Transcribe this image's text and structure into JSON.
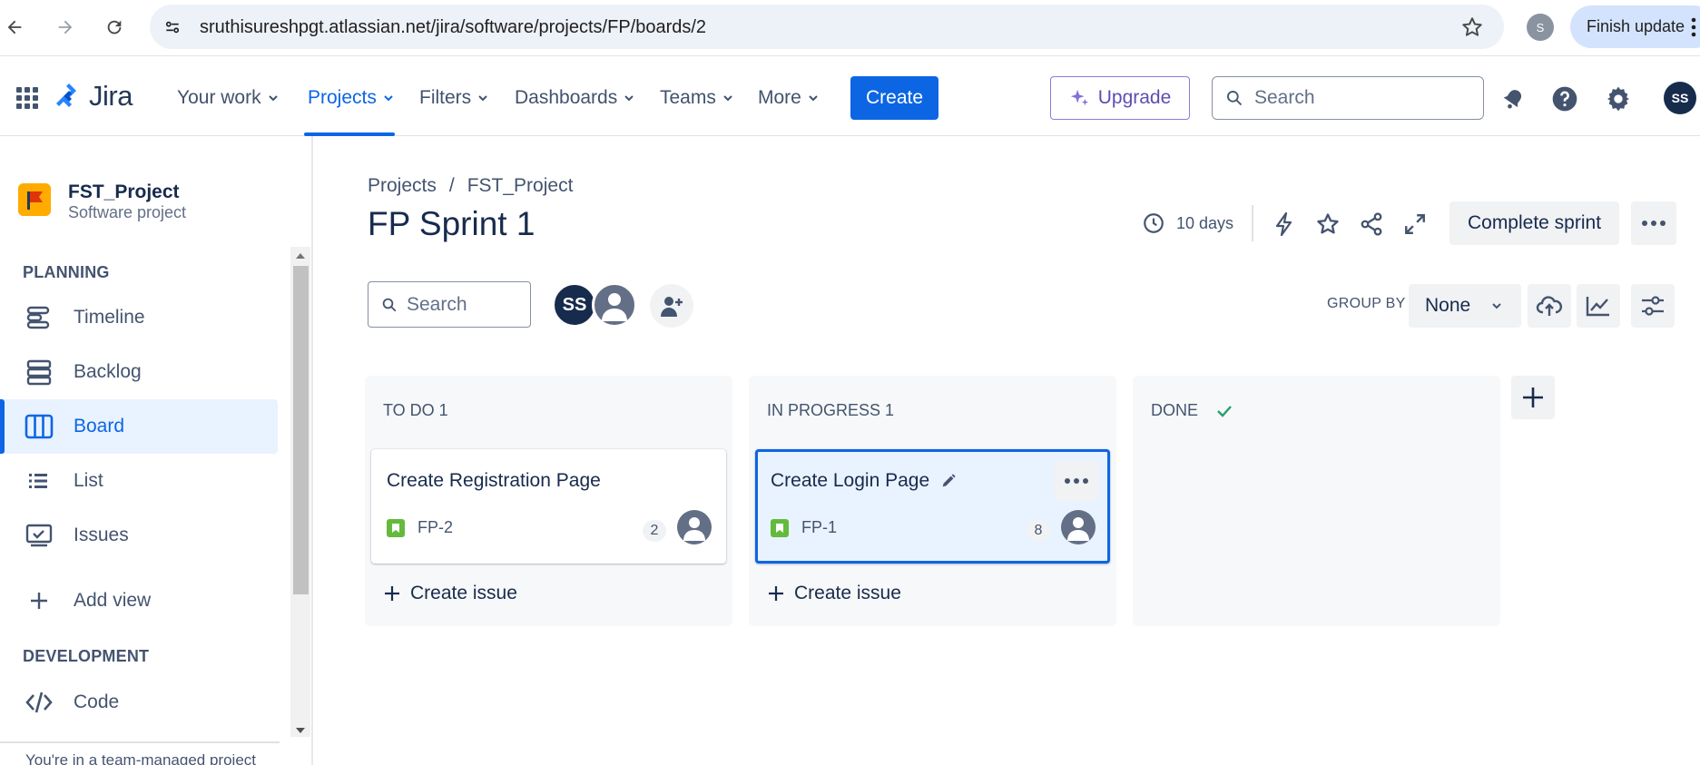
{
  "browser": {
    "url": "sruthisureshpgt.atlassian.net/jira/software/projects/FP/boards/2",
    "profile_initial": "S",
    "finish_update_label": "Finish update"
  },
  "topnav": {
    "logo_text": "Jira",
    "items": [
      {
        "label": "Your work"
      },
      {
        "label": "Projects"
      },
      {
        "label": "Filters"
      },
      {
        "label": "Dashboards"
      },
      {
        "label": "Teams"
      },
      {
        "label": "More"
      }
    ],
    "create_label": "Create",
    "upgrade_label": "Upgrade",
    "search_placeholder": "Search",
    "avatar_initials": "SS"
  },
  "sidebar": {
    "project_name": "FST_Project",
    "project_type": "Software project",
    "planning_heading": "PLANNING",
    "items": [
      {
        "label": "Timeline",
        "icon": "timeline-icon"
      },
      {
        "label": "Backlog",
        "icon": "backlog-icon"
      },
      {
        "label": "Board",
        "icon": "board-icon",
        "active": true
      },
      {
        "label": "List",
        "icon": "list-icon"
      },
      {
        "label": "Issues",
        "icon": "issues-icon"
      }
    ],
    "add_view_label": "Add view",
    "development_heading": "DEVELOPMENT",
    "code_label": "Code",
    "team_note": "You're in a team-managed project"
  },
  "main": {
    "breadcrumb": [
      "Projects",
      "/",
      "FST_Project"
    ],
    "sprint_title": "FP Sprint 1",
    "days_remaining": "10 days",
    "complete_sprint_label": "Complete sprint",
    "search_placeholder": "Search",
    "avatar_initials": "SS",
    "group_by_label": "GROUP BY",
    "group_by_value": "None"
  },
  "board": {
    "columns": [
      {
        "title": "TO DO 1",
        "cards": [
          {
            "title": "Create Registration Page",
            "key": "FP-2",
            "estimate": "2"
          }
        ],
        "create_label": "Create issue"
      },
      {
        "title": "IN PROGRESS 1",
        "cards": [
          {
            "title": "Create Login Page",
            "key": "FP-1",
            "estimate": "8",
            "selected": true
          }
        ],
        "create_label": "Create issue"
      },
      {
        "title": "DONE",
        "cards": [],
        "create_label": ""
      }
    ]
  },
  "colors": {
    "accent": "#0c66e4",
    "text": "#172b4d",
    "subtle": "#44546f",
    "column_bg": "#f7f8f9",
    "story": "#63ba3c",
    "done_check": "#22a06b"
  }
}
